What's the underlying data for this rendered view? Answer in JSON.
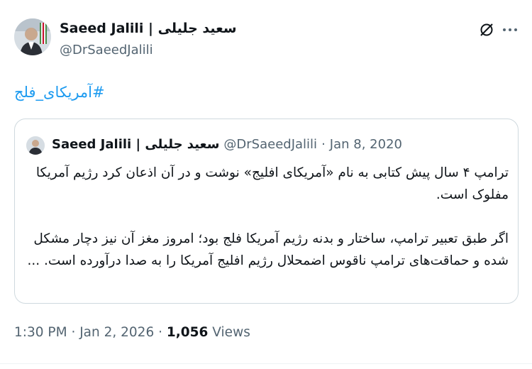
{
  "author": {
    "display_name": "Saeed Jalili | سعید جلیلی",
    "handle": "@DrSaeedJalili",
    "avatar_icon": "profile-photo"
  },
  "tweet": {
    "hashtag": "#آمریکای_فلج"
  },
  "quote": {
    "display_name": "Saeed Jalili | سعید جلیلی",
    "handle": "@DrSaeedJalili",
    "date": "Jan 8, 2020",
    "paragraphs": [
      "ترامپ ۴ سال پیش کتابی به نام «آمریکای افلیج» نوشت و در آن اذعان کرد رژیم آمریکا مفلوک است.",
      "اگر طبق تعبیر ترامپ، ساختار و بدنه رژیم آمریکا فلج بود؛ امروز مغز آن نیز دچار مشکل شده و حماقت‌های ترامپ ناقوس اضمحلال رژیم افلیج آمریکا را به صدا درآورده است. ..."
    ]
  },
  "footer": {
    "time": "1:30 PM",
    "date": "Jan 2, 2026",
    "views_count": "1,056",
    "views_label": "Views"
  },
  "colors": {
    "link": "#1d9bf0",
    "secondary_text": "#536471",
    "primary_text": "#0f1419",
    "border": "#cfd9de"
  },
  "icons": [
    "grok-icon",
    "more-options-icon"
  ]
}
